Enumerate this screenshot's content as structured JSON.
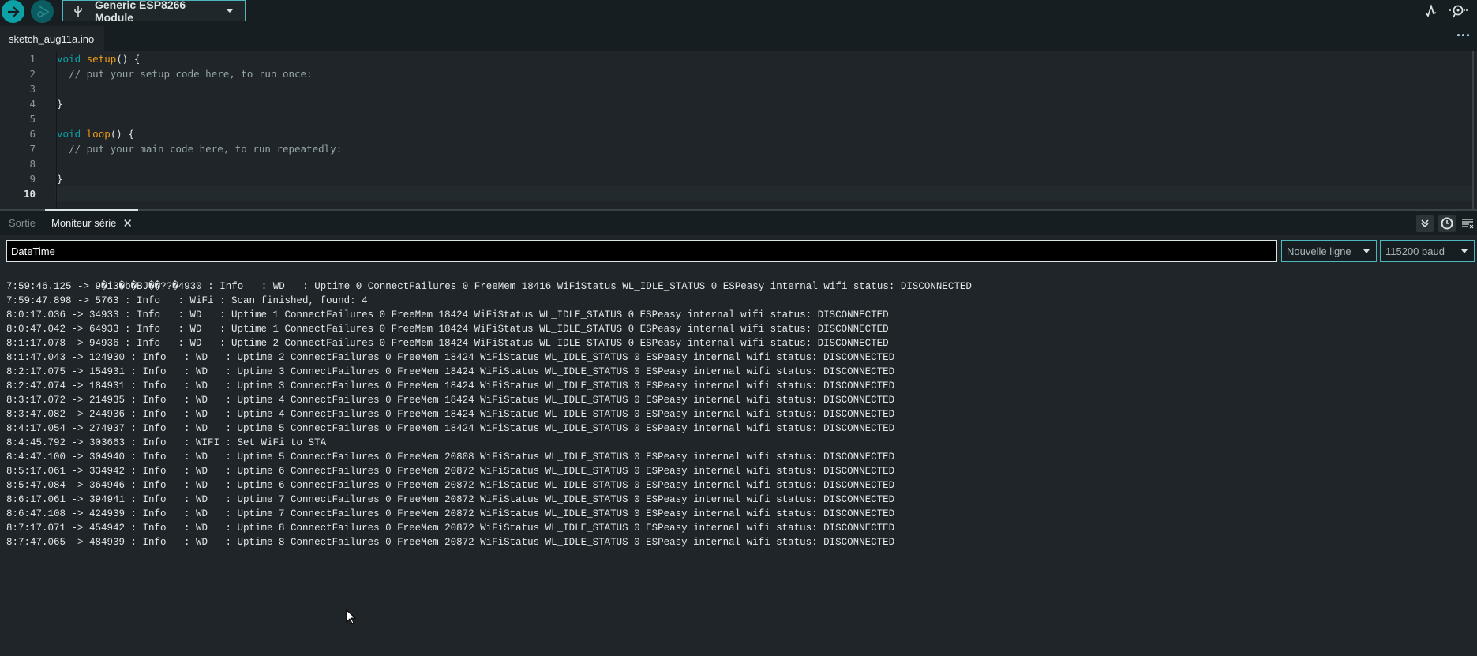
{
  "toolbar": {
    "verify_icon": "arrow-right-icon",
    "debug_icon": "debug-icon",
    "board": "Generic ESP8266 Module",
    "board_icon": "usb-icon",
    "plotter_icon": "serial-plotter-icon",
    "monitor_icon": "serial-monitor-icon"
  },
  "file_tab": {
    "name": "sketch_aug11a.ino",
    "more_icon": "ellipsis-icon"
  },
  "editor": {
    "line_numbers": [
      "1",
      "2",
      "3",
      "4",
      "5",
      "6",
      "7",
      "8",
      "9",
      "10"
    ],
    "active_line": 10,
    "lines": [
      {
        "kw": "void",
        "fn": "setup",
        "rest": "() {",
        "cm": ""
      },
      {
        "kw": "",
        "fn": "",
        "rest": "  ",
        "cm": "// put your setup code here, to run once:"
      },
      {
        "kw": "",
        "fn": "",
        "rest": "",
        "cm": ""
      },
      {
        "kw": "",
        "fn": "",
        "rest": "}",
        "cm": ""
      },
      {
        "kw": "",
        "fn": "",
        "rest": "",
        "cm": ""
      },
      {
        "kw": "void",
        "fn": "loop",
        "rest": "() {",
        "cm": ""
      },
      {
        "kw": "",
        "fn": "",
        "rest": "  ",
        "cm": "// put your main code here, to run repeatedly:"
      },
      {
        "kw": "",
        "fn": "",
        "rest": "",
        "cm": ""
      },
      {
        "kw": "",
        "fn": "",
        "rest": "}",
        "cm": ""
      },
      {
        "kw": "",
        "fn": "",
        "rest": "",
        "cm": ""
      }
    ]
  },
  "panel": {
    "tabs": {
      "output": "Sortie",
      "monitor": "Moniteur série",
      "close": "✕"
    },
    "filter_value": "DateTime",
    "line_ending": "Nouvelle ligne",
    "baud": "115200 baud",
    "log": [
      "7:59:46.125 -> 9�i3�b�BJ��??�4930 : Info   : WD   : Uptime 0 ConnectFailures 0 FreeMem 18416 WiFiStatus WL_IDLE_STATUS 0 ESPeasy internal wifi status: DISCONNECTED",
      "7:59:47.898 -> 5763 : Info   : WiFi : Scan finished, found: 4",
      "8:0:17.036 -> 34933 : Info   : WD   : Uptime 1 ConnectFailures 0 FreeMem 18424 WiFiStatus WL_IDLE_STATUS 0 ESPeasy internal wifi status: DISCONNECTED",
      "8:0:47.042 -> 64933 : Info   : WD   : Uptime 1 ConnectFailures 0 FreeMem 18424 WiFiStatus WL_IDLE_STATUS 0 ESPeasy internal wifi status: DISCONNECTED",
      "8:1:17.078 -> 94936 : Info   : WD   : Uptime 2 ConnectFailures 0 FreeMem 18424 WiFiStatus WL_IDLE_STATUS 0 ESPeasy internal wifi status: DISCONNECTED",
      "8:1:47.043 -> 124930 : Info   : WD   : Uptime 2 ConnectFailures 0 FreeMem 18424 WiFiStatus WL_IDLE_STATUS 0 ESPeasy internal wifi status: DISCONNECTED",
      "8:2:17.075 -> 154931 : Info   : WD   : Uptime 3 ConnectFailures 0 FreeMem 18424 WiFiStatus WL_IDLE_STATUS 0 ESPeasy internal wifi status: DISCONNECTED",
      "8:2:47.074 -> 184931 : Info   : WD   : Uptime 3 ConnectFailures 0 FreeMem 18424 WiFiStatus WL_IDLE_STATUS 0 ESPeasy internal wifi status: DISCONNECTED",
      "8:3:17.072 -> 214935 : Info   : WD   : Uptime 4 ConnectFailures 0 FreeMem 18424 WiFiStatus WL_IDLE_STATUS 0 ESPeasy internal wifi status: DISCONNECTED",
      "8:3:47.082 -> 244936 : Info   : WD   : Uptime 4 ConnectFailures 0 FreeMem 18424 WiFiStatus WL_IDLE_STATUS 0 ESPeasy internal wifi status: DISCONNECTED",
      "8:4:17.054 -> 274937 : Info   : WD   : Uptime 5 ConnectFailures 0 FreeMem 18424 WiFiStatus WL_IDLE_STATUS 0 ESPeasy internal wifi status: DISCONNECTED",
      "8:4:45.792 -> 303663 : Info   : WIFI : Set WiFi to STA",
      "8:4:47.100 -> 304940 : Info   : WD   : Uptime 5 ConnectFailures 0 FreeMem 20808 WiFiStatus WL_IDLE_STATUS 0 ESPeasy internal wifi status: DISCONNECTED",
      "8:5:17.061 -> 334942 : Info   : WD   : Uptime 6 ConnectFailures 0 FreeMem 20872 WiFiStatus WL_IDLE_STATUS 0 ESPeasy internal wifi status: DISCONNECTED",
      "8:5:47.084 -> 364946 : Info   : WD   : Uptime 6 ConnectFailures 0 FreeMem 20872 WiFiStatus WL_IDLE_STATUS 0 ESPeasy internal wifi status: DISCONNECTED",
      "8:6:17.061 -> 394941 : Info   : WD   : Uptime 7 ConnectFailures 0 FreeMem 20872 WiFiStatus WL_IDLE_STATUS 0 ESPeasy internal wifi status: DISCONNECTED",
      "8:6:47.108 -> 424939 : Info   : WD   : Uptime 7 ConnectFailures 0 FreeMem 20872 WiFiStatus WL_IDLE_STATUS 0 ESPeasy internal wifi status: DISCONNECTED",
      "8:7:17.071 -> 454942 : Info   : WD   : Uptime 8 ConnectFailures 0 FreeMem 20872 WiFiStatus WL_IDLE_STATUS 0 ESPeasy internal wifi status: DISCONNECTED",
      "8:7:47.065 -> 484939 : Info   : WD   : Uptime 8 ConnectFailures 0 FreeMem 20872 WiFiStatus WL_IDLE_STATUS 0 ESPeasy internal wifi status: DISCONNECTED"
    ]
  },
  "colors": {
    "accent": "#0ca1a6",
    "keyword": "#0ca1a6",
    "function": "#f39c12",
    "comment": "#95a5a6"
  }
}
